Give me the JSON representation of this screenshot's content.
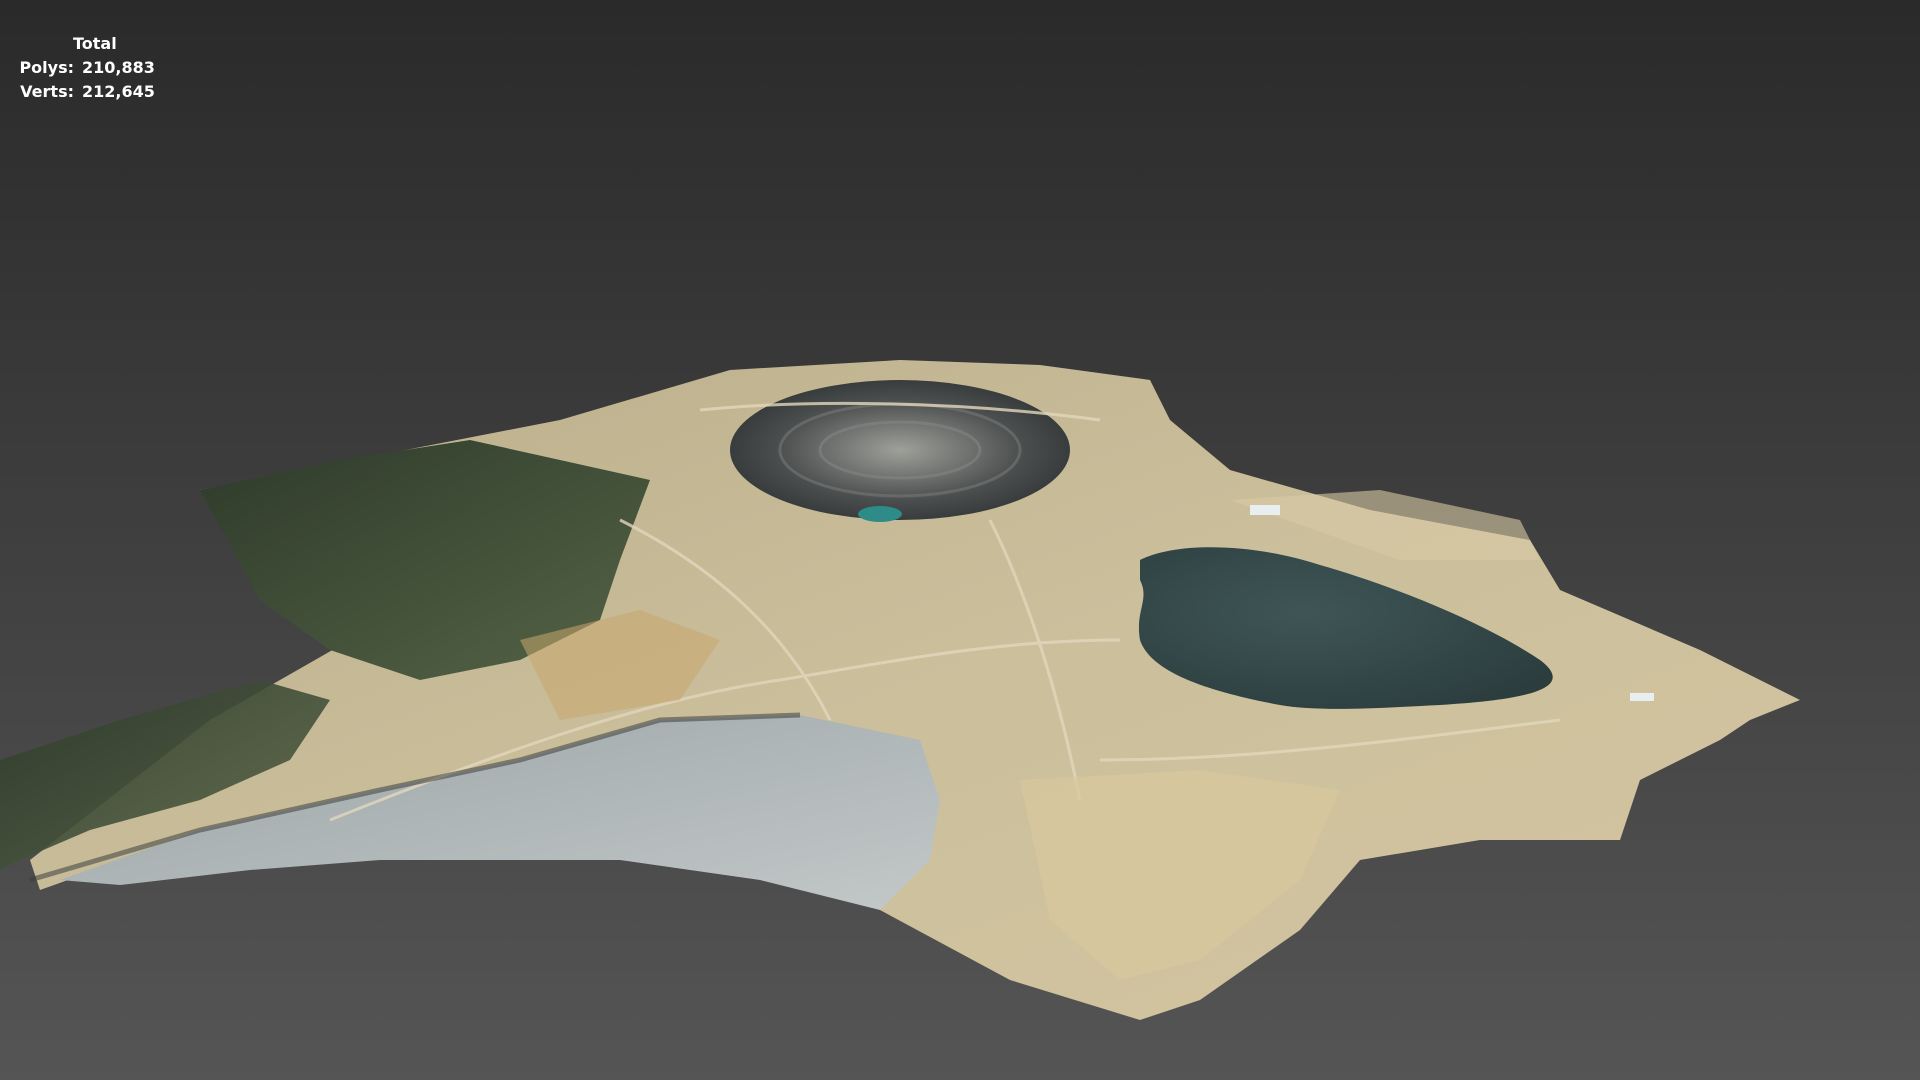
{
  "viewport": {
    "stats_title": "Total",
    "polys_label": "Polys:",
    "polys_value": "210,883",
    "verts_label": "Verts:",
    "verts_value": "212,645"
  },
  "colors": {
    "background_top": "#2a2a2a",
    "background_bottom": "#555555",
    "terrain_base": "#c9b893",
    "vegetation": "#3f4f37",
    "pit_lake": "#35494a",
    "tailings": "#aab2b5"
  }
}
